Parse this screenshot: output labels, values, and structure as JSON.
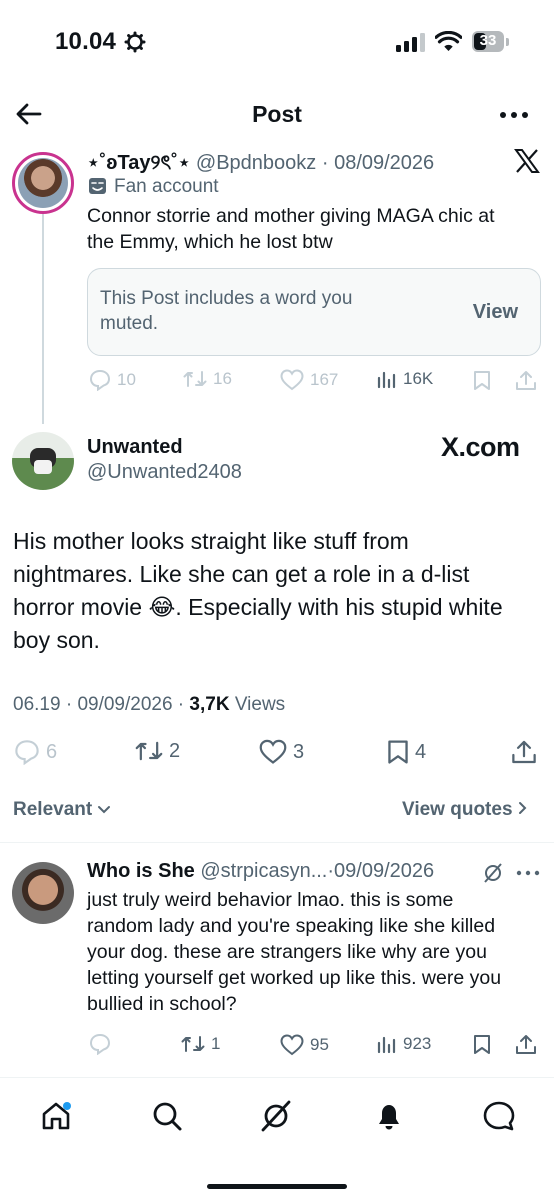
{
  "status_bar": {
    "time": "10.04",
    "battery": "33"
  },
  "header": {
    "title": "Post"
  },
  "quoted_post": {
    "name": "⋆˚ʚTay୨ৎ˚⋆",
    "handle": "@Bpdnbookz",
    "date": "08/09/2026",
    "badge": "Fan account",
    "text_line1": "Connor storrie and mother giving MAGA chic at",
    "text_line2": "the Emmy, which he lost btw",
    "muted_notice_line1": "This Post includes a word you",
    "muted_notice_line2": "muted.",
    "view_label": "View",
    "stats": {
      "replies": "10",
      "reposts": "16",
      "likes": "167",
      "views": "16K"
    }
  },
  "main_post": {
    "name": "Unwanted",
    "handle": "@Unwanted2408",
    "watermark": "X.com",
    "text_line1": "His mother looks straight like stuff from",
    "text_line2": "nightmares. Like she can get a role in a d-list",
    "text_line3": "horror movie 😂. Especially with his stupid white",
    "text_line4": "boy son.",
    "time": "06.19",
    "date": "09/09/2026",
    "views_count": "3,7K",
    "views_label": "Views",
    "stats": {
      "replies": "6",
      "reposts": "2",
      "likes": "3",
      "bookmarks": "4"
    }
  },
  "sort": {
    "label": "Relevant",
    "view_quotes": "View quotes"
  },
  "reply": {
    "name": "Who is She",
    "handle": "@strpicasyn...",
    "date": "09/09/2026",
    "text_line1": "just truly weird behavior lmao. this is some",
    "text_line2": "random lady and you're speaking like she killed",
    "text_line3": "your dog. these are strangers like why are you",
    "text_line4": "letting yourself get worked up like this. were you",
    "text_line5": "bullied in school?",
    "stats": {
      "reposts": "1",
      "likes": "95",
      "views": "923"
    }
  },
  "colors": {
    "text": "#0f1419",
    "secondary": "#536471",
    "accent": "#1d9bf0",
    "border": "#eff3f4"
  }
}
